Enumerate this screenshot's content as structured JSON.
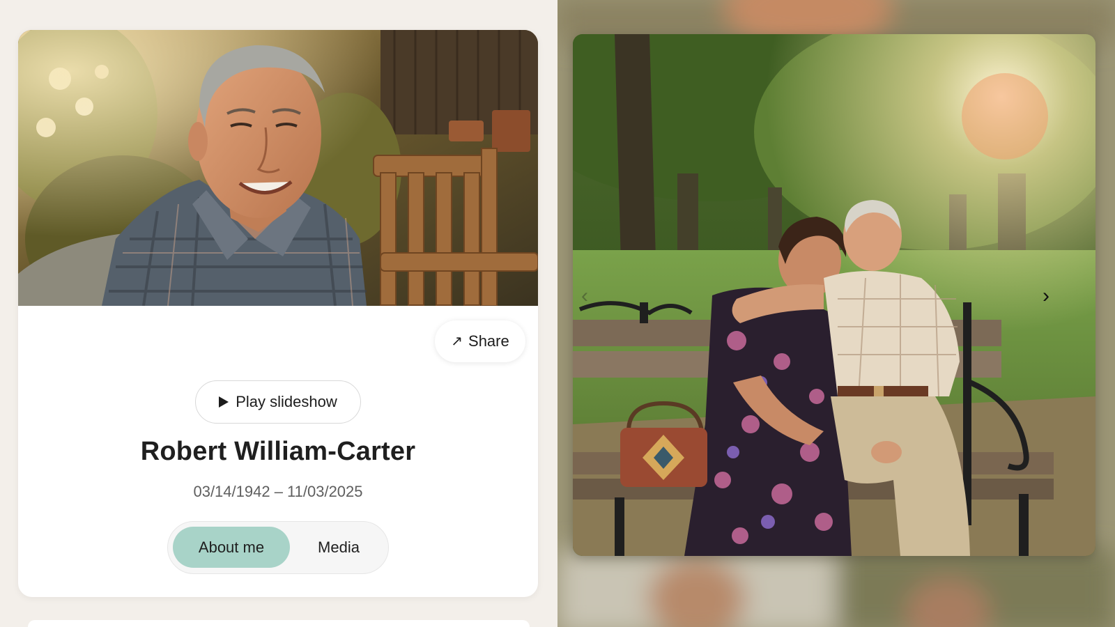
{
  "profile": {
    "name": "Robert William-Carter",
    "dates": "03/14/1942 – 11/03/2025",
    "hero_photo_alt": "Smiling elderly man in plaid shirt sitting in a garden"
  },
  "actions": {
    "share_label": "Share",
    "share_icon": "arrow-up-right-icon",
    "slideshow_label": "Play slideshow",
    "slideshow_icon": "play-icon"
  },
  "tabs": [
    {
      "label": "About me",
      "active": true
    },
    {
      "label": "Media",
      "active": false
    }
  ],
  "gallery": {
    "current_photo_alt": "Elderly couple embracing on a park bench",
    "prev_icon": "chevron-left-icon",
    "next_icon": "chevron-right-icon"
  },
  "colors": {
    "page_background": "#f3efea",
    "card_background": "#ffffff",
    "active_tab": "#a8d3c8"
  }
}
